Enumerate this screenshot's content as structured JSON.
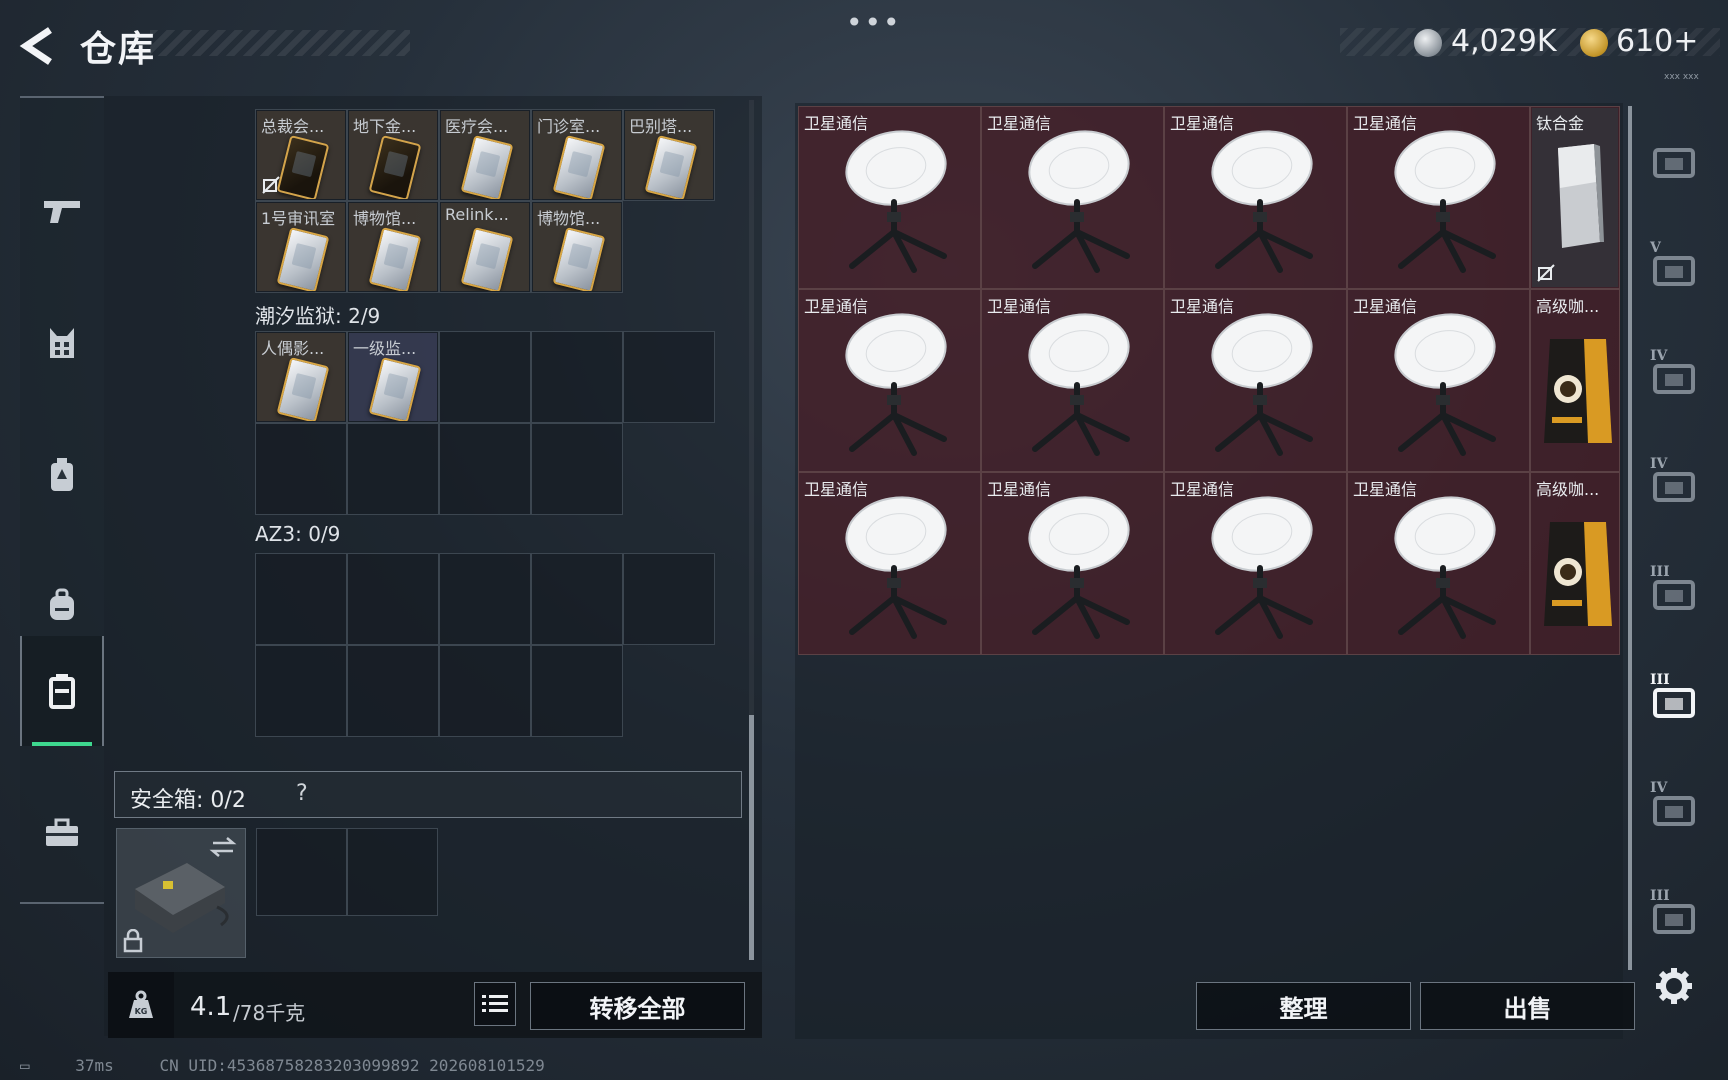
{
  "header": {
    "title": "仓库",
    "more": "•••",
    "currency": {
      "money": "4,029K",
      "gold": "610+"
    },
    "corner_text": "xxx xxx"
  },
  "left_rail": [
    "gun-icon",
    "armor-icon",
    "chest-rig-icon",
    "backpack-icon",
    "container-icon",
    "briefcase-icon"
  ],
  "left_panel": {
    "top_container": {
      "items": [
        {
          "name": "总裁会...",
          "style": "dark",
          "no_sell": true
        },
        {
          "name": "地下金...",
          "style": "dark"
        },
        {
          "name": "医疗会...",
          "style": "light"
        },
        {
          "name": "门诊室...",
          "style": "light"
        },
        {
          "name": "巴别塔...",
          "style": "light"
        },
        {
          "name": "1号审讯室",
          "style": "light"
        },
        {
          "name": "博物馆...",
          "style": "light"
        },
        {
          "name": "Relink...",
          "style": "light"
        },
        {
          "name": "博物馆...",
          "style": "light"
        }
      ]
    },
    "tide_prison": {
      "label": "潮汐监狱: 2/9",
      "items": [
        {
          "name": "人偶影...",
          "style": "light"
        },
        {
          "name": "一级监...",
          "style": "light",
          "blue": true
        }
      ]
    },
    "az3": {
      "label": "AZ3: 0/9"
    },
    "safe_box": {
      "label": "安全箱: 0/2",
      "help": "?"
    },
    "weight": {
      "current": "4.1",
      "max": "/78千克"
    },
    "transfer_all": "转移全部"
  },
  "right_panel": {
    "items": [
      {
        "name": "卫星通信",
        "kind": "dish"
      },
      {
        "name": "卫星通信",
        "kind": "dish"
      },
      {
        "name": "卫星通信",
        "kind": "dish"
      },
      {
        "name": "卫星通信",
        "kind": "dish"
      },
      {
        "name": "钛合金",
        "kind": "titanium",
        "no_sell": true
      },
      {
        "name": "卫星通信",
        "kind": "dish"
      },
      {
        "name": "卫星通信",
        "kind": "dish"
      },
      {
        "name": "卫星通信",
        "kind": "dish"
      },
      {
        "name": "卫星通信",
        "kind": "dish"
      },
      {
        "name": "高级咖...",
        "kind": "coffee"
      },
      {
        "name": "卫星通信",
        "kind": "dish"
      },
      {
        "name": "卫星通信",
        "kind": "dish"
      },
      {
        "name": "卫星通信",
        "kind": "dish"
      },
      {
        "name": "卫星通信",
        "kind": "dish"
      },
      {
        "name": "高级咖...",
        "kind": "coffee"
      }
    ],
    "tidy": "整理",
    "sell": "出售"
  },
  "right_rail": [
    {
      "tier": "",
      "icon": "vault-icon"
    },
    {
      "tier": "V",
      "icon": "safe-icon"
    },
    {
      "tier": "IV",
      "icon": "folder-icon"
    },
    {
      "tier": "IV",
      "icon": "folder-icon"
    },
    {
      "tier": "III",
      "icon": "rack-icon"
    },
    {
      "tier": "III",
      "icon": "workbench-icon"
    },
    {
      "tier": "IV",
      "icon": "medical-icon"
    },
    {
      "tier": "III",
      "icon": "range-icon"
    }
  ],
  "status": {
    "ping": "37ms",
    "uid": "CN UID:4536875828320309989​2 202608101529"
  },
  "colors": {
    "accent_green": "#3ed88f",
    "item_red": "#5a1e26"
  }
}
